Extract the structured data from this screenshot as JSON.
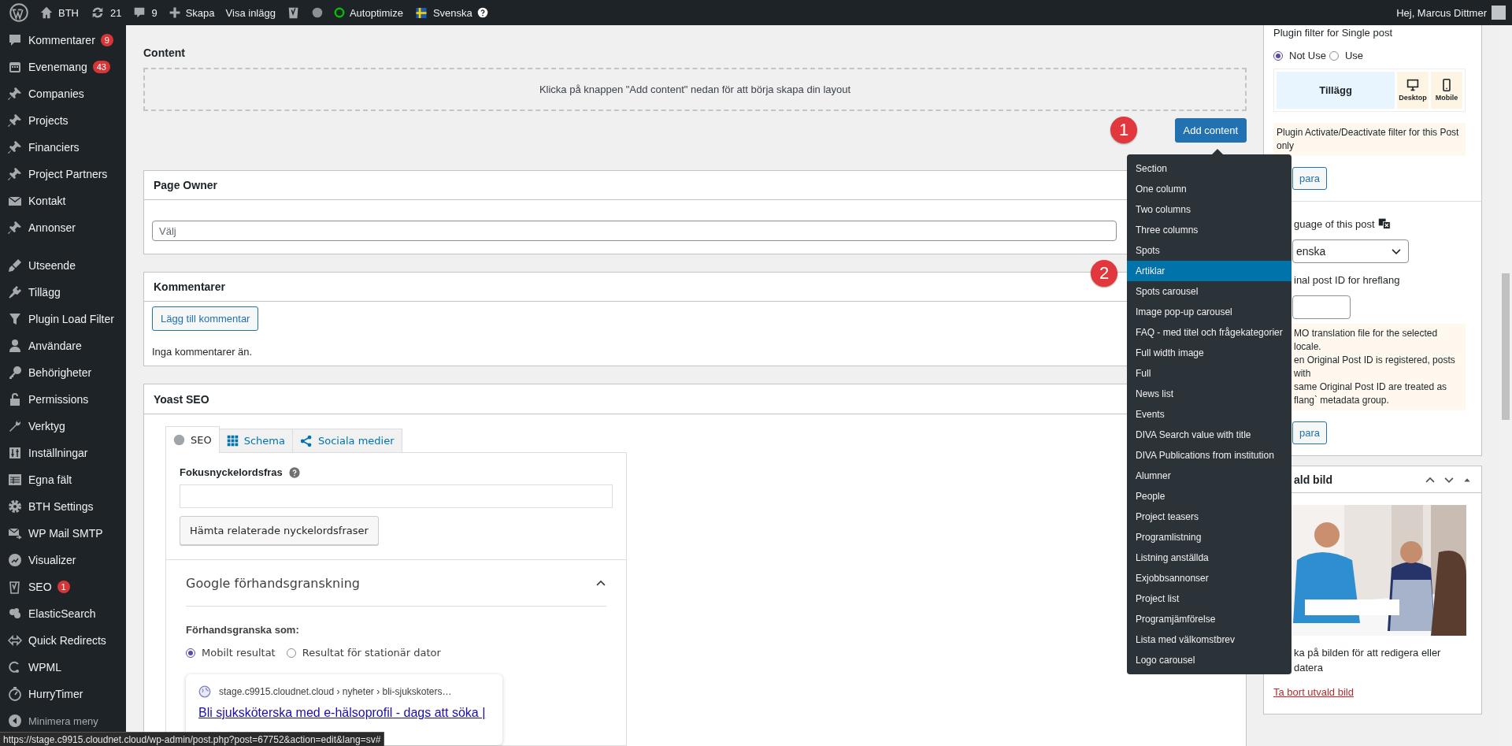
{
  "admin_bar": {
    "site": "BTH",
    "updates": "21",
    "comments": "9",
    "new": "Skapa",
    "view": "Visa inlägg",
    "autoptimize": "Autoptimize",
    "language": "Svenska",
    "greeting": "Hej, Marcus Dittmer"
  },
  "sidebar": {
    "sections": [
      {
        "items": [
          {
            "label": "Kommentarer",
            "badge": "9"
          },
          {
            "label": "Evenemang",
            "badge": "43"
          },
          {
            "label": "Companies"
          },
          {
            "label": "Projects"
          },
          {
            "label": "Financiers"
          },
          {
            "label": "Project Partners"
          },
          {
            "label": "Kontakt"
          },
          {
            "label": "Annonser"
          }
        ]
      },
      {
        "items": [
          {
            "label": "Utseende"
          },
          {
            "label": "Tillägg"
          },
          {
            "label": "Plugin Load Filter"
          },
          {
            "label": "Användare"
          },
          {
            "label": "Behörigheter"
          },
          {
            "label": "Permissions"
          },
          {
            "label": "Verktyg"
          },
          {
            "label": "Inställningar"
          },
          {
            "label": "Egna fält"
          },
          {
            "label": "BTH Settings"
          },
          {
            "label": "WP Mail SMTP"
          },
          {
            "label": "Visualizer"
          },
          {
            "label": "SEO",
            "badge": "1"
          },
          {
            "label": "ElasticSearch"
          },
          {
            "label": "Quick Redirects"
          },
          {
            "label": "WPML"
          },
          {
            "label": "HurryTimer"
          }
        ]
      }
    ],
    "collapse_label": "Minimera meny"
  },
  "content_builder": {
    "title": "Content",
    "empty_text": "Klicka på knappen \"Add content\" nedan för att börja skapa din layout",
    "button": "Add content",
    "menu": [
      {
        "label": "Section",
        "selected": false
      },
      {
        "label": "One column",
        "selected": false
      },
      {
        "label": "Two columns",
        "selected": false
      },
      {
        "label": "Three columns",
        "selected": false
      },
      {
        "label": "Spots",
        "selected": false
      },
      {
        "label": "Artiklar",
        "selected": true
      },
      {
        "label": "Spots carousel",
        "selected": false
      },
      {
        "label": "Image pop-up carousel",
        "selected": false
      },
      {
        "label": "FAQ - med titel och frågekategorier",
        "selected": false
      },
      {
        "label": "Full width image",
        "selected": false
      },
      {
        "label": "Full",
        "selected": false
      },
      {
        "label": "News list",
        "selected": false
      },
      {
        "label": "Events",
        "selected": false
      },
      {
        "label": "DIVA Search value with title",
        "selected": false
      },
      {
        "label": "DIVA Publications from institution",
        "selected": false
      },
      {
        "label": "Alumner",
        "selected": false
      },
      {
        "label": "People",
        "selected": false
      },
      {
        "label": "Project teasers",
        "selected": false
      },
      {
        "label": "Programlistning",
        "selected": false
      },
      {
        "label": "Listning anställda",
        "selected": false
      },
      {
        "label": "Exjobbsannonser",
        "selected": false
      },
      {
        "label": "Project list",
        "selected": false
      },
      {
        "label": "Programjämförelse",
        "selected": false
      },
      {
        "label": "Lista med välkomstbrev",
        "selected": false
      },
      {
        "label": "Logo carousel",
        "selected": false
      }
    ]
  },
  "step_markers": [
    {
      "number": "1"
    },
    {
      "number": "2"
    }
  ],
  "page_owner": {
    "title": "Page Owner",
    "placeholder": "Välj"
  },
  "comments_box": {
    "title": "Kommentarer",
    "button": "Lägg till kommentar",
    "empty_text": "Inga kommentarer än."
  },
  "yoast": {
    "title": "Yoast SEO",
    "tabs": [
      {
        "label": "SEO",
        "selected": true
      },
      {
        "label": "Schema",
        "selected": false
      },
      {
        "label": "Sociala medier",
        "selected": false
      }
    ],
    "focus_label": "Fokusnyckelordsfras",
    "related_button": "Hämta relaterade nyckelordsfraser",
    "preview": {
      "title": "Google förhandsgranskning",
      "expanded": true,
      "preview_as": "Förhandsgranska som:",
      "options": [
        {
          "label": "Mobilt resultat",
          "selected": true
        },
        {
          "label": "Resultat för stationär dator",
          "selected": false
        }
      ],
      "breadcrumb": "stage.c9915.cloudnet.cloud › nyheter › bli-sjukskoters…",
      "result_title": "Bli sjuksköterska med e-hälsoprofil - dags att söka |"
    }
  },
  "side_panel": {
    "filter_title": "Plugin filter for Single post",
    "filter_options": [
      {
        "label": "Not Use",
        "selected": true
      },
      {
        "label": "Use",
        "selected": false
      }
    ],
    "filter_table": {
      "plugin": "Tillägg",
      "desktop": "Desktop",
      "mobile": "Mobile"
    },
    "filter_note": "Plugin Activate/Deactivate filter for this Post only",
    "save_button": "para",
    "language_label": "guage of this post",
    "language_value": "enska",
    "original_id_label": "inal post ID for hreflang",
    "note_lines": [
      "MO translation file for the selected locale.",
      "en Original Post ID is registered, posts with",
      "same Original Post ID are treated as",
      "flang` metadata group."
    ],
    "save_button_2": "para"
  },
  "featured_image": {
    "title": "ald bild",
    "picture": {
      "kind": "picture"
    },
    "hint_lines": [
      "ka på bilden för att redigera eller",
      "datera"
    ],
    "remove_link": "Ta bort utvald bild"
  },
  "status_url": "https://stage.c9915.cloudnet.cloud/wp-admin/post.php?post=67752&action=edit&lang=sv#"
}
